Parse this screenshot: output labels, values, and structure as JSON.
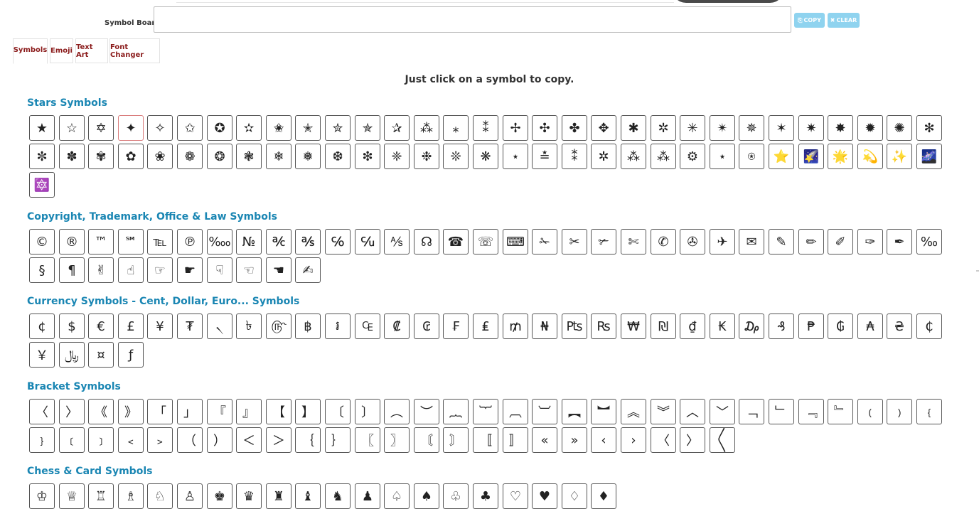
{
  "board": {
    "label": "Symbol Board",
    "value": ""
  },
  "buttons": {
    "copy_icon": "⎘",
    "copy_label": "COPY",
    "clear_icon": "✖",
    "clear_label": "CLEAR"
  },
  "tabs": [
    {
      "label": "Symbols",
      "active": true
    },
    {
      "label": "Emoji",
      "active": false
    },
    {
      "label": "Text Art",
      "active": false
    },
    {
      "label": "Font Changer",
      "active": false
    }
  ],
  "hint": "Just click on a symbol to copy.",
  "sections": [
    {
      "title": "Stars Symbols",
      "symbols": [
        "★",
        "☆",
        "✡",
        "✦",
        "✧",
        "✩",
        "✪",
        "✫",
        "✬",
        "✭",
        "✮",
        "✯",
        "✰",
        "⁂",
        "⁎",
        "⁑",
        "✢",
        "✣",
        "✤",
        "✥",
        "✱",
        "✲",
        "✳",
        "✴",
        "✵",
        "✶",
        "✷",
        "✸",
        "✹",
        "✺",
        "✻",
        "✼",
        "✽",
        "✾",
        "✿",
        "❀",
        "❁",
        "❂",
        "❃",
        "❄",
        "❅",
        "❆",
        "❇",
        "❈",
        "❉",
        "❊",
        "❋",
        "⋆",
        "≛",
        "⁑",
        "✲",
        "⁂",
        "⁂",
        "⚙",
        "⋆",
        "⍟",
        "⭐",
        "🌠",
        "🌟",
        "💫",
        "✨",
        "🌌",
        "🔯"
      ],
      "highlight": [
        3
      ]
    },
    {
      "title": "Copyright, Trademark, Office & Law Symbols",
      "symbols": [
        "©",
        "®",
        "™",
        "℠",
        "℡",
        "℗",
        "‱",
        "№",
        "℀",
        "℁",
        "℅",
        "℆",
        "⅍",
        "☊",
        "☎",
        "☏",
        "⌨",
        "✁",
        "✂",
        "✃",
        "✄",
        "✆",
        "✇",
        "✈",
        "✉",
        "✎",
        "✏",
        "✐",
        "✑",
        "✒",
        "‰",
        "§",
        "¶",
        "✌",
        "☝",
        "☞",
        "☛",
        "☟",
        "☜",
        "☚",
        "✍"
      ],
      "highlight": []
    },
    {
      "title": "Currency Symbols - Cent, Dollar, Euro... Symbols",
      "symbols": [
        "¢",
        "$",
        "€",
        "£",
        "¥",
        "₮",
        "৲",
        "৳",
        "௹",
        "฿",
        "៛",
        "₠",
        "₡",
        "₢",
        "₣",
        "₤",
        "₥",
        "₦",
        "₧",
        "₨",
        "₩",
        "₪",
        "₫",
        "₭",
        "₯",
        "₰",
        "₱",
        "₲",
        "₳",
        "₴",
        "₵",
        "￥",
        "﷼",
        "¤",
        "ƒ"
      ],
      "highlight": []
    },
    {
      "title": "Bracket Symbols",
      "symbols": [
        "〈",
        "〉",
        "《",
        "》",
        "「",
        "」",
        "『",
        "』",
        "【",
        "】",
        "〔",
        "〕",
        "︵",
        "︶",
        "︷",
        "︸",
        "︹",
        "︺",
        "︻",
        "︼",
        "︽",
        "︾",
        "︿",
        "﹀",
        "﹁",
        "﹂",
        "﹃",
        "﹄",
        "﹙",
        "﹚",
        "﹛",
        "﹜",
        "﹝",
        "﹞",
        "﹤",
        "﹥",
        "（",
        "）",
        "＜",
        "＞",
        "｛",
        "｝",
        "〖",
        "〗",
        "〘",
        "〙",
        "〚",
        "〛",
        "«",
        "»",
        "‹",
        "›",
        "〈",
        "〉",
        "〱"
      ],
      "highlight": []
    },
    {
      "title": "Chess & Card Symbols",
      "symbols": [
        "♔",
        "♕",
        "♖",
        "♗",
        "♘",
        "♙",
        "♚",
        "♛",
        "♜",
        "♝",
        "♞",
        "♟",
        "♤",
        "♠",
        "♧",
        "♣",
        "♡",
        "♥",
        "♢",
        "♦"
      ],
      "highlight": []
    }
  ]
}
